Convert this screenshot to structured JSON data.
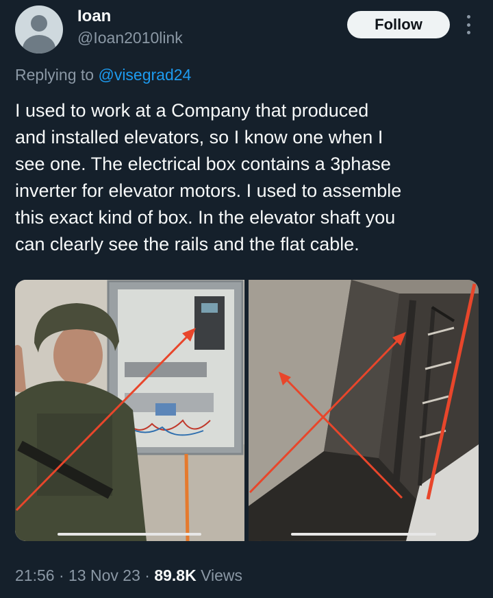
{
  "author": {
    "name": "Ioan",
    "handle": "@Ioan2010link",
    "avatar_icon": "default-avatar-icon"
  },
  "header": {
    "follow_label": "Follow",
    "more_icon": "more-vertical-icon"
  },
  "reply": {
    "prefix": "Replying to",
    "mention": "@visegrad24"
  },
  "tweet": {
    "lines": [
      "I used to work at a Company that produced",
      "and installed elevators, so I know one when I",
      "see one. The electrical box contains a 3phase",
      "inverter for elevator motors. I used to assemble",
      "this exact kind of box. In the elevator shaft you",
      "can clearly see the rails and the flat cable."
    ]
  },
  "media": {
    "left_image": "soldier-next-to-electrical-box-photo",
    "right_image": "elevator-shaft-photo",
    "annotation_color": "#e8462b"
  },
  "meta": {
    "time": "21:56",
    "sep1": "·",
    "date": "13 Nov 23",
    "sep2": "·",
    "views_count": "89.8K",
    "views_label": "Views"
  },
  "colors": {
    "background": "#15202b",
    "text": "#f7f9f9",
    "secondary": "#8b98a5",
    "link": "#1d9bf0"
  }
}
